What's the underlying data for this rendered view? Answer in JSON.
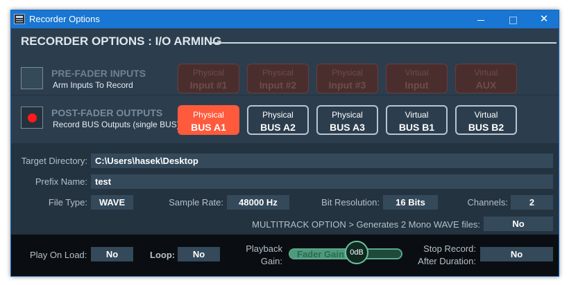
{
  "window": {
    "title": "Recorder Options",
    "controls": {
      "minimize": "—",
      "maximize": "☐",
      "close": "✕"
    }
  },
  "header": {
    "title": "RECORDER OPTIONS : I/O ARMING"
  },
  "pre_fader": {
    "label": "PRE-FADER INPUTS",
    "sublabel": "Arm Inputs To Record",
    "armed": false,
    "buttons": [
      {
        "type": "Physical",
        "name": "Input #1"
      },
      {
        "type": "Physical",
        "name": "Input #2"
      },
      {
        "type": "Physical",
        "name": "Input #3"
      },
      {
        "type": "Virtual",
        "name": "Input"
      },
      {
        "type": "Virtual",
        "name": "AUX"
      }
    ]
  },
  "post_fader": {
    "label": "POST-FADER OUTPUTS",
    "sublabel": "Record BUS Outputs (single BUS)",
    "armed": true,
    "buttons": [
      {
        "type": "Physical",
        "name": "BUS A1",
        "active": true
      },
      {
        "type": "Physical",
        "name": "BUS A2",
        "active": false
      },
      {
        "type": "Physical",
        "name": "BUS A3",
        "active": false
      },
      {
        "type": "Virtual",
        "name": "BUS B1",
        "active": false
      },
      {
        "type": "Virtual",
        "name": "BUS B2",
        "active": false
      }
    ]
  },
  "settings": {
    "target_directory": {
      "label": "Target Directory:",
      "value": "C:\\Users\\hasek\\Desktop"
    },
    "prefix_name": {
      "label": "Prefix Name:",
      "value": "test"
    },
    "file_type": {
      "label": "File Type:",
      "value": "WAVE"
    },
    "sample_rate": {
      "label": "Sample Rate:",
      "value": "48000 Hz"
    },
    "bit_resolution": {
      "label": "Bit Resolution:",
      "value": "16 Bits"
    },
    "channels": {
      "label": "Channels:",
      "value": "2"
    },
    "multitrack": {
      "label": "MULTITRACK OPTION > Generates 2 Mono WAVE files:",
      "value": "No"
    }
  },
  "bottom": {
    "play_on_load": {
      "label": "Play On Load:",
      "value": "No"
    },
    "loop": {
      "label": "Loop:",
      "value": "No"
    },
    "playback_gain": {
      "label_line1": "Playback",
      "label_line2": "Gain:",
      "fader_label": "Fader Gain",
      "value": "0dB",
      "level": 0.6
    },
    "stop_record": {
      "label_line1": "Stop Record:",
      "label_line2": "After Duration:",
      "value": "No"
    }
  },
  "colors": {
    "accent": "#1976d2",
    "active_bus": "#ff5a3c",
    "arm_red": "#ff1a1a",
    "fader_green": "#4d9b7c"
  }
}
